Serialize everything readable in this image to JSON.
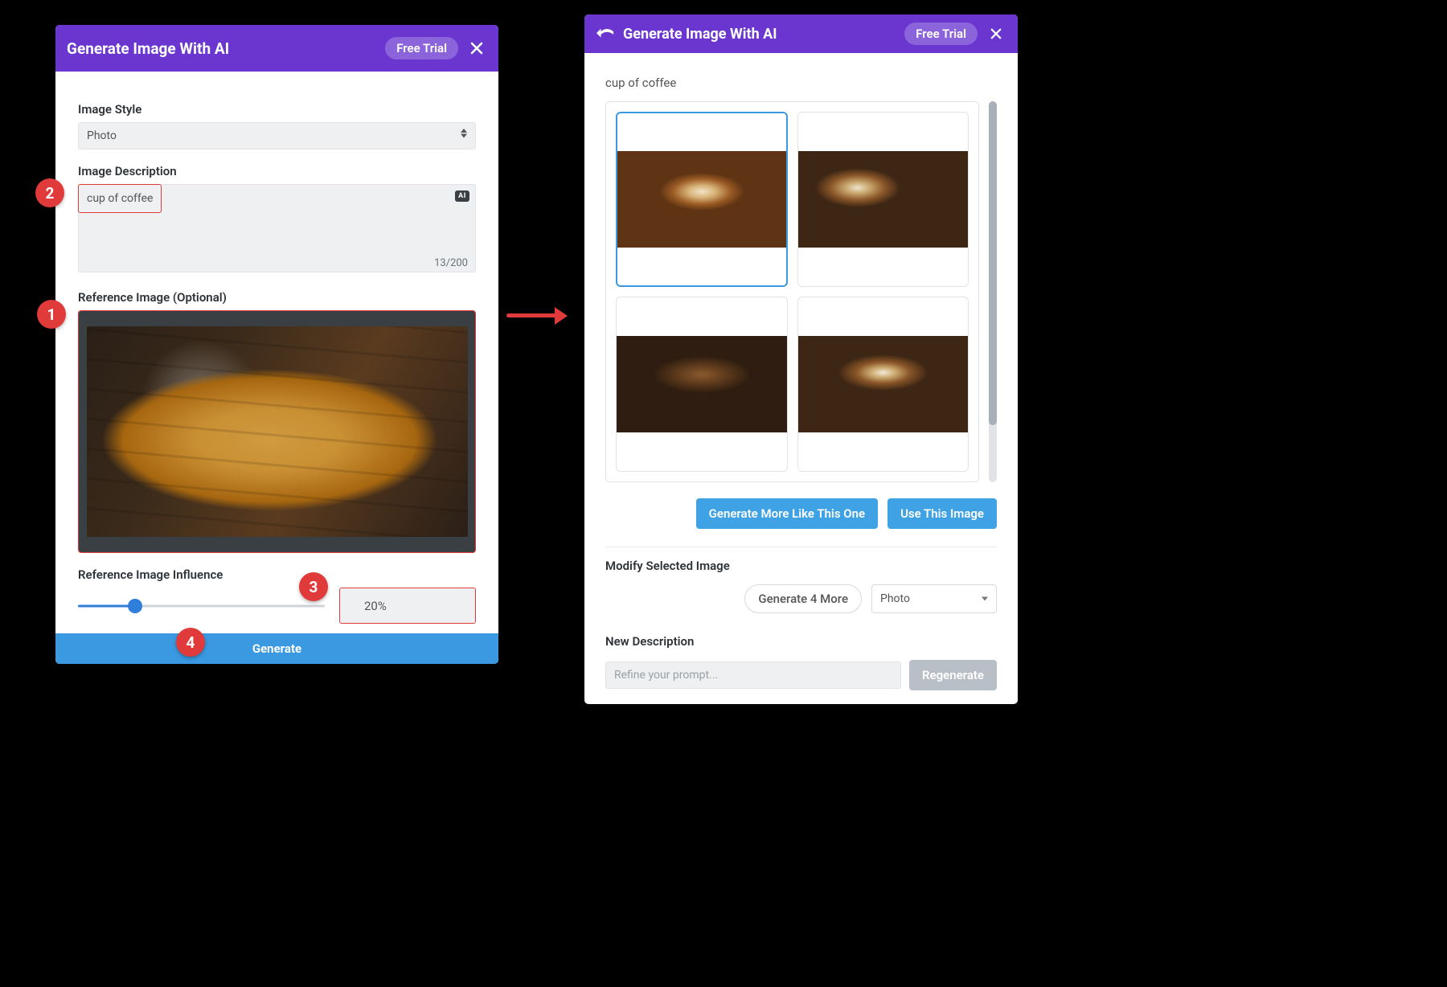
{
  "left": {
    "header": {
      "title": "Generate Image With AI",
      "free_trial": "Free Trial"
    },
    "image_style": {
      "label": "Image Style",
      "value": "Photo"
    },
    "description": {
      "label": "Image Description",
      "value": "cup of coffee",
      "ai_badge": "AI",
      "charcount": "13/200"
    },
    "reference": {
      "label": "Reference Image (Optional)"
    },
    "influence": {
      "label": "Reference Image Influence",
      "value": "20%"
    },
    "generate_label": "Generate"
  },
  "right": {
    "header": {
      "title": "Generate Image With AI",
      "free_trial": "Free Trial"
    },
    "prompt": "cup of coffee",
    "buttons": {
      "more_like": "Generate More Like This One",
      "use_image": "Use This Image"
    },
    "modify": {
      "title": "Modify Selected Image",
      "gen4": "Generate 4 More",
      "style": "Photo"
    },
    "new_desc": {
      "title": "New Description",
      "placeholder": "Refine your prompt...",
      "regenerate": "Regenerate"
    }
  },
  "annotations": {
    "one": "1",
    "two": "2",
    "three": "3",
    "four": "4"
  }
}
